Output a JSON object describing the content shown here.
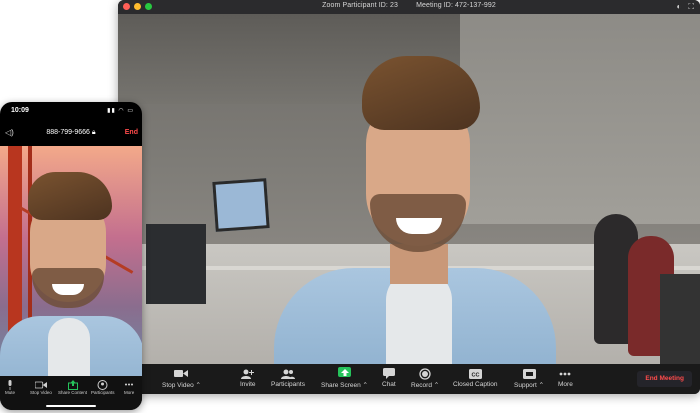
{
  "desktop": {
    "title": {
      "participant_id": "Zoom Participant ID: 23",
      "meeting_id": "Meeting ID: 472-137-992"
    },
    "toolbar": {
      "stop_video": "Stop Video",
      "invite": "Invite",
      "participants": "Participants",
      "share_screen": "Share Screen",
      "chat": "Chat",
      "record": "Record",
      "closed_caption": "Closed Caption",
      "support": "Support",
      "more": "More",
      "end_meeting": "End Meeting"
    }
  },
  "phone": {
    "status_time": "10:09",
    "phone_number": "888-799-9666",
    "end_label": "End",
    "toolbar": {
      "mute": "Mute",
      "stop_video": "Stop Video",
      "share_content": "Share Content",
      "participants": "Participants",
      "more": "More"
    }
  },
  "colors": {
    "end_red": "#ff4b4b",
    "share_green": "#26c35b",
    "toolbar_bg": "#1a1a1a"
  }
}
